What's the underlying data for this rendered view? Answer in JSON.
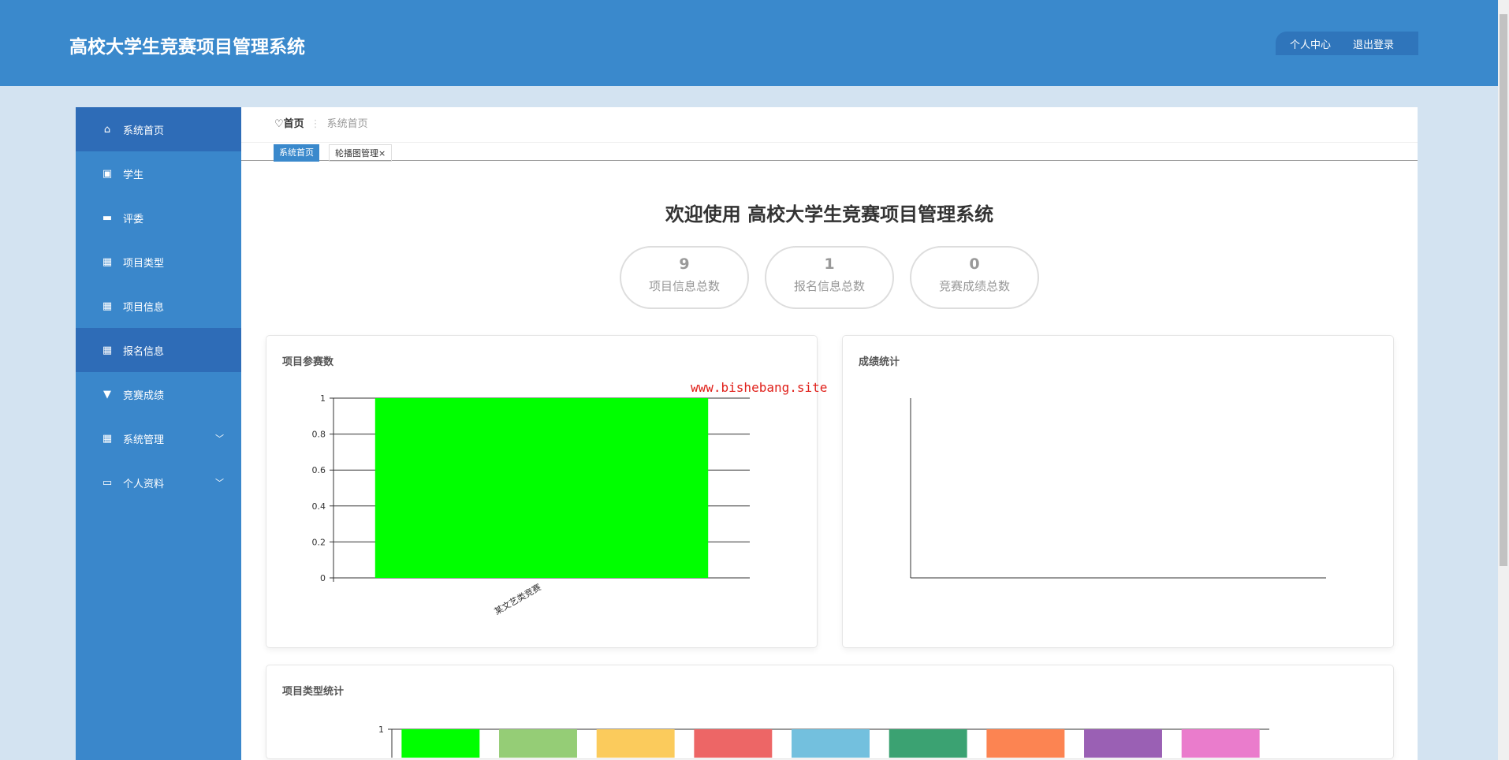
{
  "header": {
    "title": "高校大学生竞赛项目管理系统",
    "personal_center": "个人中心",
    "logout": "退出登录"
  },
  "sidebar": {
    "items": [
      {
        "label": "系统首页",
        "icon": "home-icon"
      },
      {
        "label": "学生",
        "icon": "chart-icon"
      },
      {
        "label": "评委",
        "icon": "ticket-icon"
      },
      {
        "label": "项目类型",
        "icon": "grid-icon"
      },
      {
        "label": "项目信息",
        "icon": "grid-icon"
      },
      {
        "label": "报名信息",
        "icon": "table-icon"
      },
      {
        "label": "竞赛成绩",
        "icon": "brush-icon"
      },
      {
        "label": "系统管理",
        "icon": "grid-icon"
      },
      {
        "label": "个人资料",
        "icon": "card-icon"
      }
    ]
  },
  "breadcrumb": {
    "home": "首页",
    "current": "系统首页"
  },
  "tabs": [
    {
      "label": "系统首页"
    },
    {
      "label": "轮播图管理",
      "close": "×"
    }
  ],
  "welcome": "欢迎使用 高校大学生竞赛项目管理系统",
  "stats": [
    {
      "value": "9",
      "label": "项目信息总数"
    },
    {
      "value": "1",
      "label": "报名信息总数"
    },
    {
      "value": "0",
      "label": "竞赛成绩总数"
    }
  ],
  "watermark": "www.bishebang.site",
  "colors": {
    "header": "#3a89cc",
    "sidebar": "#3a87cb",
    "sidebar_active": "#2e6cb7"
  },
  "chart_data": [
    {
      "type": "bar",
      "title": "项目参赛数",
      "categories": [
        "某文艺类竞赛"
      ],
      "values": [
        1
      ],
      "ylim": [
        0,
        1
      ],
      "yticks": [
        "0",
        "0.2",
        "0.4",
        "0.6",
        "0.8",
        "1"
      ],
      "colors": [
        "#00ff00"
      ]
    },
    {
      "type": "bar",
      "title": "成绩统计",
      "categories": [],
      "values": []
    },
    {
      "type": "bar",
      "title": "项目类型统计",
      "categories": [
        "",
        "",
        "",
        "",
        "",
        "",
        "",
        "",
        ""
      ],
      "values": [
        1,
        1,
        1,
        1,
        1,
        1,
        1,
        1,
        1
      ],
      "ylim": [
        0,
        1
      ],
      "yticks": [
        "1"
      ],
      "colors": [
        "#00ff00",
        "#95cd76",
        "#fbcb5c",
        "#ed6666",
        "#73c0de",
        "#3ba272",
        "#fc8452",
        "#9a60b4",
        "#ea7ccc"
      ]
    }
  ]
}
